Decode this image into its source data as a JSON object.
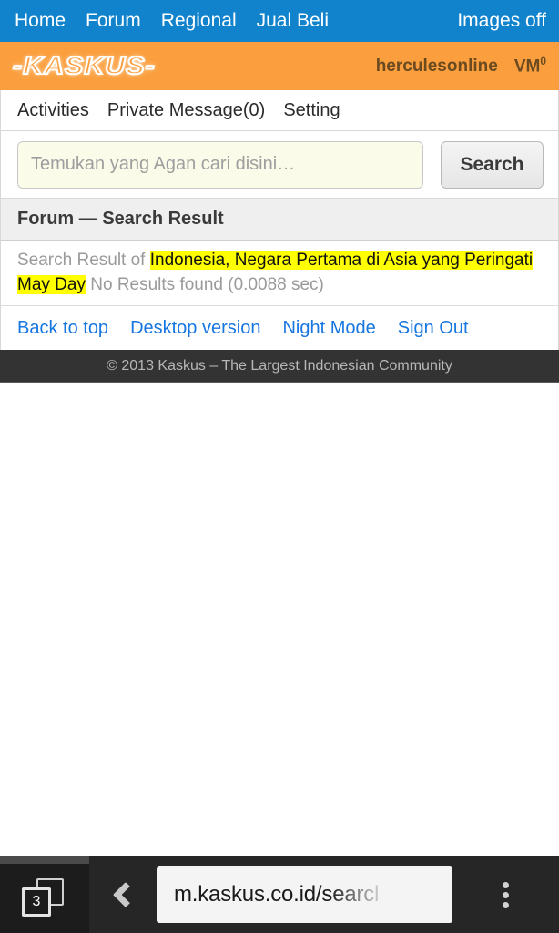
{
  "topnav": {
    "items": [
      {
        "label": "Home"
      },
      {
        "label": "Forum"
      },
      {
        "label": "Regional"
      },
      {
        "label": "Jual Beli"
      }
    ],
    "right": {
      "label": "Images off"
    }
  },
  "brandbar": {
    "logo": "-KASKUS-",
    "username": "herculesonline",
    "vm_label": "VM",
    "vm_count": "0"
  },
  "subnav": {
    "items": [
      {
        "label": "Activities"
      },
      {
        "label": "Private Message(0)"
      },
      {
        "label": "Setting"
      }
    ]
  },
  "search": {
    "placeholder": "Temukan yang Agan cari disini…",
    "value": "",
    "button_label": "Search"
  },
  "section": {
    "title": "Forum — Search Result"
  },
  "result": {
    "prefix": "Search Result of ",
    "query": "Indonesia, Negara Pertama di Asia yang Peringati May Day",
    "status": " No Results found (0.0088 sec)",
    "highlight_color": "#ffff00"
  },
  "footlinks": {
    "items": [
      {
        "label": "Back to top"
      },
      {
        "label": "Desktop version"
      },
      {
        "label": "Night Mode"
      },
      {
        "label": "Sign Out"
      }
    ]
  },
  "copyright": {
    "text": "© 2013 Kaskus – The Largest Indonesian Community"
  },
  "browser": {
    "tab_count": "3",
    "url_visible": "m.kaskus.co.id",
    "url_faded": "/searcl",
    "back_icon": "back-chevron-icon",
    "menu_icon": "overflow-menu-icon",
    "tabs_icon": "tab-count-icon"
  },
  "colors": {
    "topnav_blue": "#1183cc",
    "brand_orange": "#fb9f3e",
    "link_blue": "#1776e0",
    "footer_dark": "#333333",
    "chrome_dark": "#262626"
  }
}
